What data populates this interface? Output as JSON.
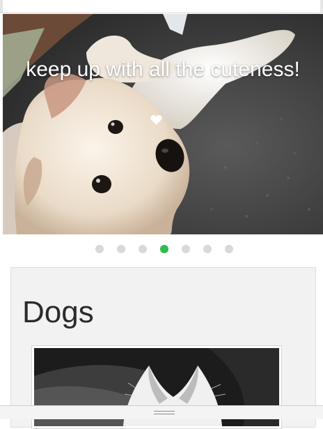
{
  "hero": {
    "caption": "keep up with all the cuteness!",
    "image": "puppies-photo",
    "hearts": [
      {
        "icon": "heart-filled-icon",
        "filled": true
      },
      {
        "icon": "heart-outline-icon",
        "filled": false
      }
    ]
  },
  "carousel": {
    "dot_count": 7,
    "active_index": 3,
    "active_color": "#2ebd4e",
    "inactive_color": "#d9d9d9"
  },
  "section": {
    "title": "Dogs",
    "image": "dog-photo-bw"
  },
  "colors": {
    "accent": "#2ebd4e",
    "card_bg": "#f2f2f2"
  }
}
